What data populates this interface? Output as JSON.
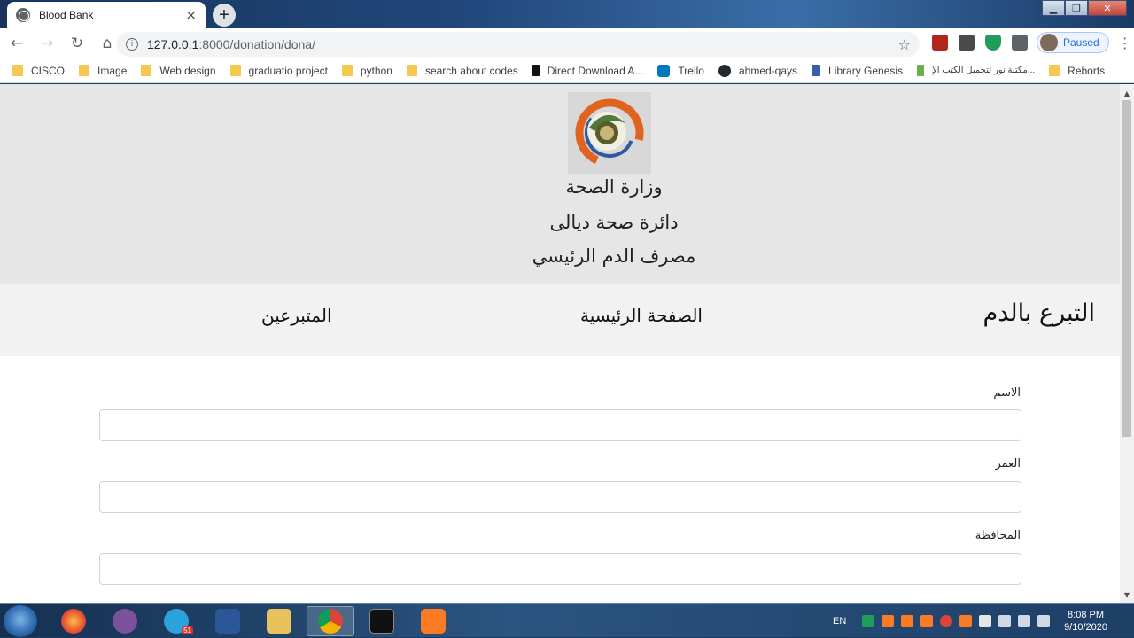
{
  "browser": {
    "tab_title": "Blood Bank",
    "tab_close": "×",
    "new_tab": "+",
    "url_host": "127.0.0.1",
    "url_path": ":8000/donation/dona/",
    "profile_status": "Paused",
    "window_controls": [
      "▁",
      "❐",
      "✕"
    ]
  },
  "bookmarks": [
    {
      "label": "CISCO",
      "icon": "folder-icon"
    },
    {
      "label": "Image",
      "icon": "folder-icon"
    },
    {
      "label": "Web design",
      "icon": "folder-icon"
    },
    {
      "label": "graduatio project",
      "icon": "folder-icon"
    },
    {
      "label": "python",
      "icon": "folder-icon"
    },
    {
      "label": "search about codes",
      "icon": "folder-icon"
    },
    {
      "label": "Direct Download A...",
      "icon": "f-logo-icon"
    },
    {
      "label": "Trello",
      "icon": "trello-icon"
    },
    {
      "label": "ahmed-qays",
      "icon": "github-icon"
    },
    {
      "label": "Library Genesis",
      "icon": "libgen-icon"
    },
    {
      "label": "مكتبة نور لتحميل الكتب الإ...",
      "icon": "noor-icon"
    },
    {
      "label": "Reborts",
      "icon": "folder-icon"
    }
  ],
  "header": {
    "line1": "وزارة الصحة",
    "line2": "دائرة صحة ديالى",
    "line3": "مصرف الدم الرئيسي"
  },
  "nav": {
    "brand": "التبرع بالدم",
    "home": "الصفحة الرئيسية",
    "donors": "المتبرعين"
  },
  "form": {
    "name_label": "الاسم",
    "age_label": "العمر",
    "province_label": "المحافظة"
  },
  "taskbar": {
    "lang": "EN",
    "time": "8:08 PM",
    "date": "9/10/2020",
    "telegram_badge": "51"
  },
  "colors": {
    "header_bg": "#e6e6e6",
    "nav_bg": "#f2f2f2",
    "logo_orange": "#e0641f",
    "logo_green": "#4f7a3a"
  }
}
